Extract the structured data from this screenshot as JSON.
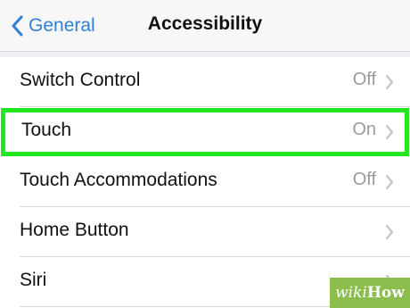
{
  "nav": {
    "back_label": "General",
    "title": "Accessibility"
  },
  "rows": [
    {
      "label": "Switch Control",
      "value": "Off"
    },
    {
      "label": "Touch",
      "value": "On"
    },
    {
      "label": "Touch Accommodations",
      "value": "Off"
    },
    {
      "label": "Home Button",
      "value": ""
    },
    {
      "label": "Siri",
      "value": ""
    }
  ],
  "watermark": {
    "part1": "wiki",
    "part2": "How"
  },
  "colors": {
    "accent": "#2f82d7",
    "highlight": "#22e61e",
    "value_text": "#9a9a9f",
    "watermark_bg": "#8bbd4f"
  },
  "icons": {
    "back": "chevron-left-icon",
    "disclosure": "chevron-right-icon"
  }
}
